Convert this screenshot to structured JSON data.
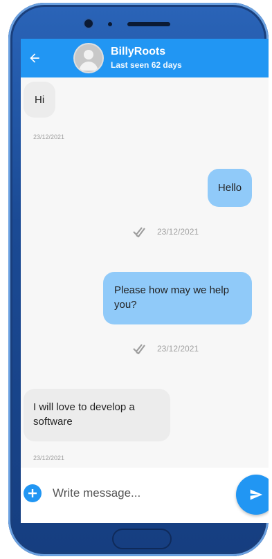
{
  "header": {
    "back_icon": "arrow-left-icon",
    "contact_name": "BillyRoots",
    "status": "Last seen 62 days"
  },
  "messages": [
    {
      "direction": "incoming",
      "text": "Hi",
      "time": "23/12/2021"
    },
    {
      "direction": "outgoing",
      "text": "Hello",
      "time": "23/12/2021",
      "status_icon": "double-check-icon"
    },
    {
      "direction": "outgoing",
      "text": "Please how may we help you?",
      "time": "23/12/2021",
      "status_icon": "double-check-icon"
    },
    {
      "direction": "incoming",
      "text": "I will love to develop a software",
      "time": "23/12/2021"
    }
  ],
  "composer": {
    "add_icon": "plus-icon",
    "placeholder": "Write message...",
    "send_icon": "send-icon"
  },
  "colors": {
    "primary": "#2196f3",
    "outgoing_bubble": "#90caf9",
    "incoming_bubble": "#ececec",
    "phone_frame": "#1f54a4"
  }
}
